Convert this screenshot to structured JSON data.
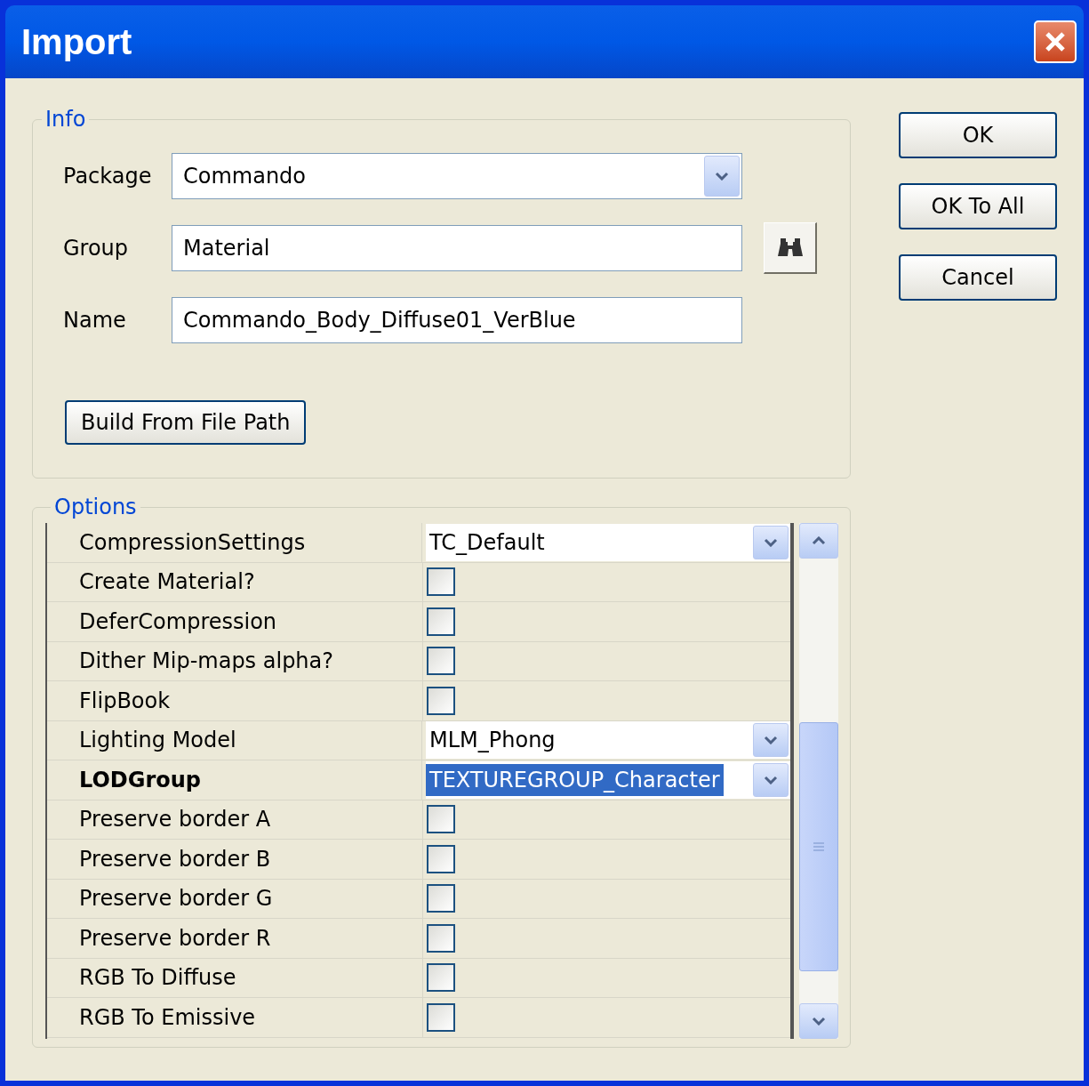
{
  "window": {
    "title": "Import"
  },
  "info": {
    "legend": "Info",
    "fields": [
      {
        "label": "Package",
        "kind": "combo",
        "value": "Commando"
      },
      {
        "label": "Group",
        "kind": "browse",
        "value": "Material"
      },
      {
        "label": "Name",
        "kind": "text",
        "value": "Commando_Body_Diffuse01_VerBlue"
      }
    ],
    "build_button": "Build From File Path"
  },
  "options": {
    "legend": "Options",
    "properties": [
      {
        "label": "CompressionSettings",
        "kind": "combo",
        "value": "TC_Default",
        "selected": false
      },
      {
        "label": "Create Material?",
        "kind": "checkbox",
        "checked": false,
        "selected": false
      },
      {
        "label": "DeferCompression",
        "kind": "checkbox",
        "checked": false,
        "selected": false
      },
      {
        "label": "Dither Mip-maps alpha?",
        "kind": "checkbox",
        "checked": false,
        "selected": false
      },
      {
        "label": "FlipBook",
        "kind": "checkbox",
        "checked": false,
        "selected": false
      },
      {
        "label": "Lighting Model",
        "kind": "combo",
        "value": "MLM_Phong",
        "selected": false
      },
      {
        "label": "LODGroup",
        "kind": "combo",
        "value": "TEXTUREGROUP_Character",
        "selected": true
      },
      {
        "label": "Preserve border A",
        "kind": "checkbox",
        "checked": false,
        "selected": false
      },
      {
        "label": "Preserve border B",
        "kind": "checkbox",
        "checked": false,
        "selected": false
      },
      {
        "label": "Preserve border G",
        "kind": "checkbox",
        "checked": false,
        "selected": false
      },
      {
        "label": "Preserve border R",
        "kind": "checkbox",
        "checked": false,
        "selected": false
      },
      {
        "label": "RGB To Diffuse",
        "kind": "checkbox",
        "checked": false,
        "selected": false
      },
      {
        "label": "RGB To Emissive",
        "kind": "checkbox",
        "checked": false,
        "selected": false
      }
    ]
  },
  "buttons": [
    "OK",
    "OK To All",
    "Cancel"
  ]
}
